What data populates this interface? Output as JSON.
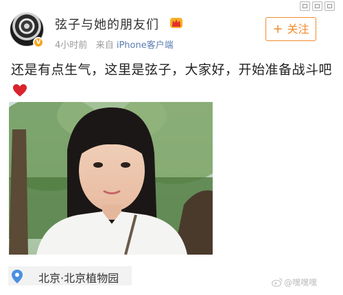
{
  "post": {
    "username": "弦子与她的朋友们",
    "time": "4小时前",
    "source_prefix": "来自",
    "source": "iPhone客户端",
    "follow_label": "关注",
    "follow_plus": "+",
    "content": "还是有点生气，这里是弦子，大家好，开始准备战斗吧",
    "verified_badge": "V",
    "location": "北京·北京植物园"
  },
  "watermark": {
    "text": "@嘿嘿嘿"
  },
  "icons": {
    "avatar": "avatar-image",
    "crown": "crown-icon",
    "heart": "heart-icon",
    "location": "location-pin-icon",
    "weibo": "weibo-logo-icon"
  },
  "colors": {
    "follow": "#f28a2b",
    "link": "#5b7db1",
    "badge": "#f5a623",
    "heart": "#d9232d",
    "location_pin": "#4a90e2"
  }
}
